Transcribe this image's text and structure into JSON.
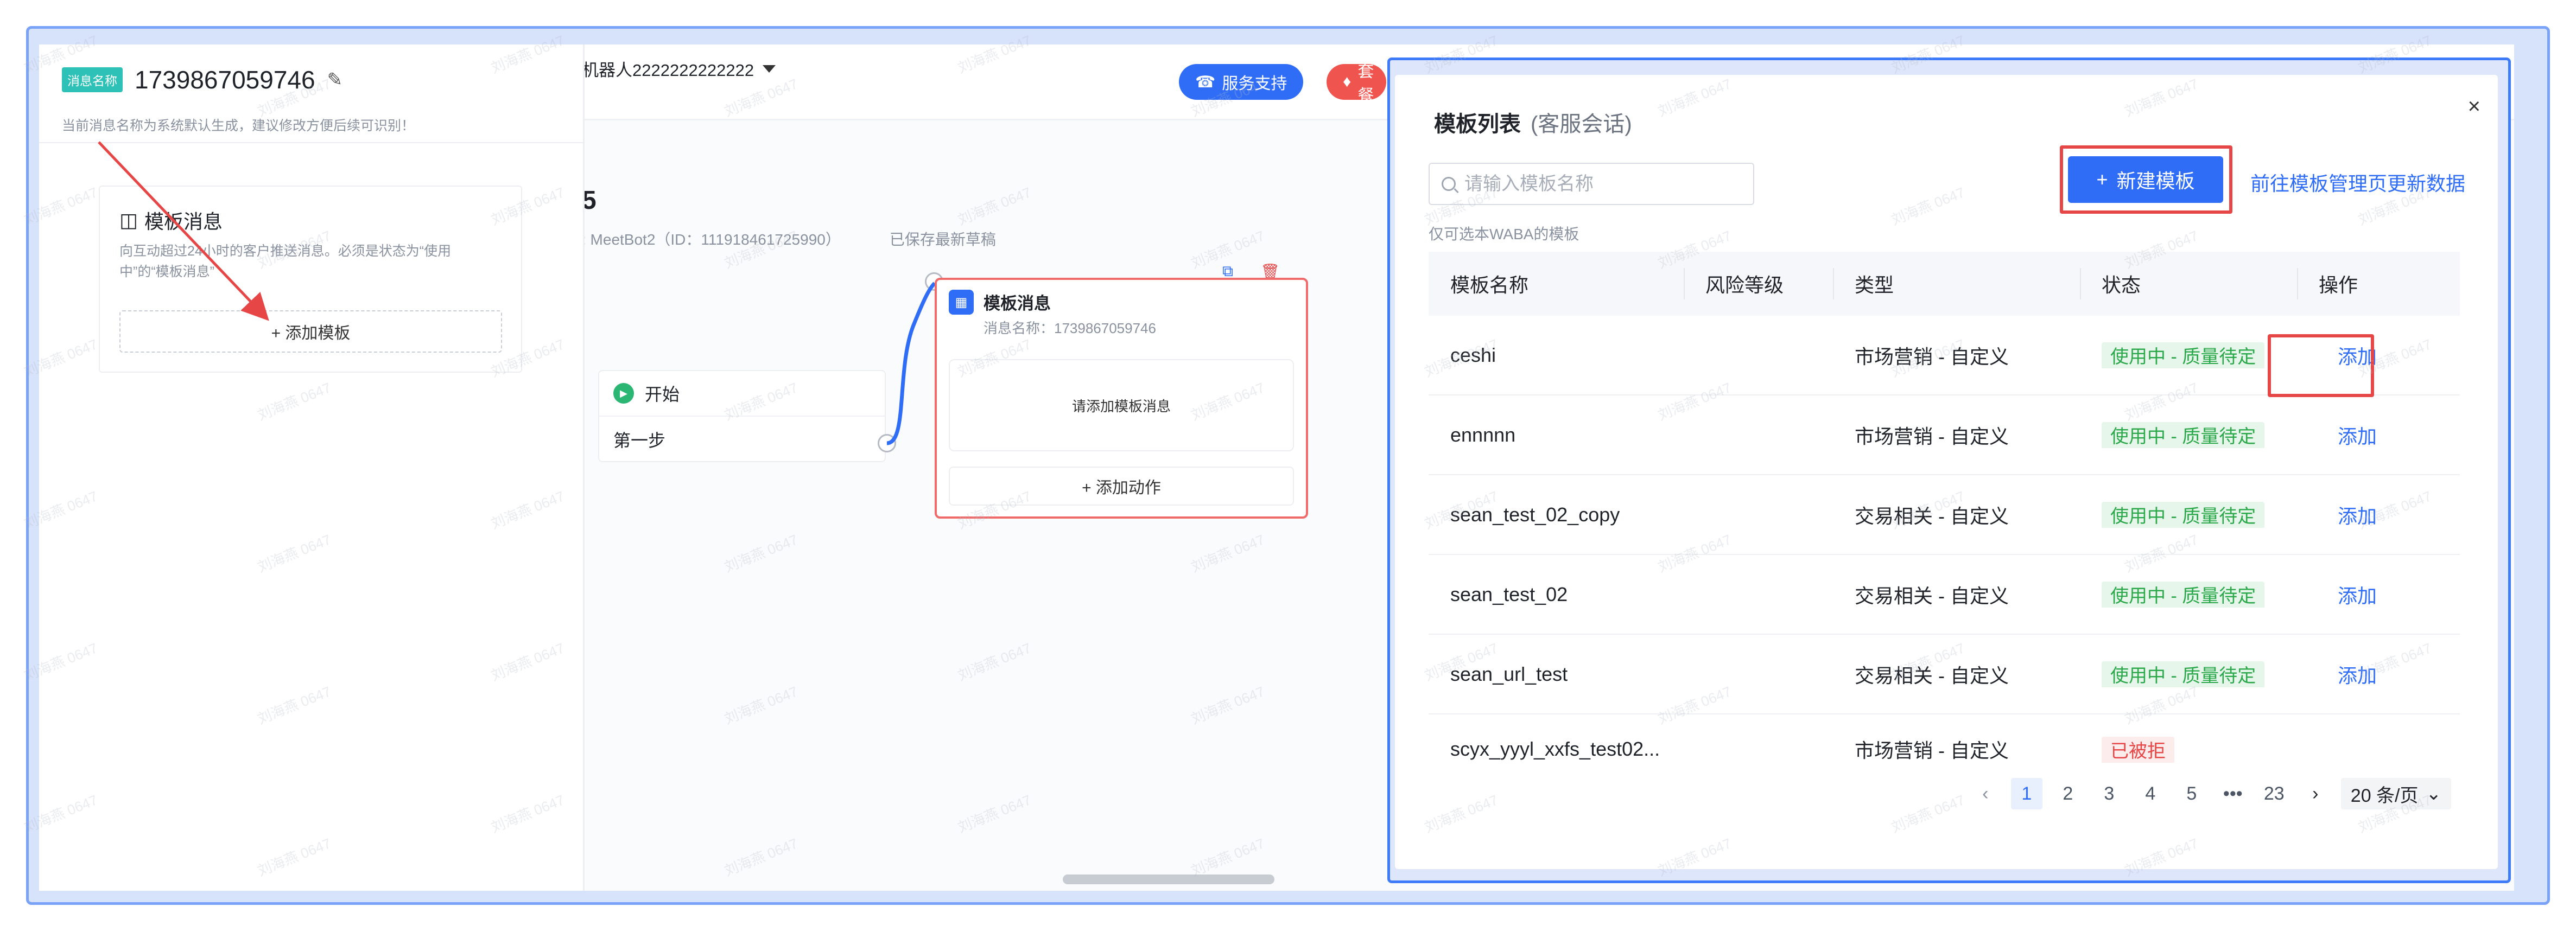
{
  "topbar": {
    "bot_name": "机器人2222222222222",
    "support_button": "服务支持",
    "package_button": "套餐"
  },
  "canvas": {
    "title_fragment": "5",
    "bot_meta": ": MeetBot2（ID：111918461725990）",
    "save_status": "已保存最新草稿",
    "start_node": {
      "label": "开始",
      "step": "第一步"
    },
    "template_node": {
      "title": "模板消息",
      "subtitle": "消息名称：1739867059746",
      "empty_text": "请添加模板消息",
      "add_action": "+ 添加动作"
    }
  },
  "left_panel": {
    "tag": "消息名称",
    "message_name": "1739867059746",
    "hint": "当前消息名称为系统默认生成，建议修改方便后续可识别！",
    "card": {
      "title": "模板消息",
      "description": "向互动超过24小时的客户推送消息。必须是状态为“使用中”的“模板消息”",
      "add_button": "+ 添加模板"
    }
  },
  "modal": {
    "title": "模板列表",
    "subtitle": "(客服会话)",
    "close": "×",
    "search_placeholder": "请输入模板名称",
    "new_button": "新建模板",
    "goto_link": "前往模板管理页更新数据",
    "waba_hint": "仅可选本WABA的模板",
    "columns": [
      "模板名称",
      "风险等级",
      "类型",
      "状态",
      "操作"
    ],
    "rows": [
      {
        "name": "ceshi",
        "risk": "",
        "type": "市场营销 - 自定义",
        "status": "使用中 - 质量待定",
        "status_kind": "ok",
        "action": "添加"
      },
      {
        "name": "ennnnn",
        "risk": "",
        "type": "市场营销 - 自定义",
        "status": "使用中 - 质量待定",
        "status_kind": "ok",
        "action": "添加"
      },
      {
        "name": "sean_test_02_copy",
        "risk": "",
        "type": "交易相关 - 自定义",
        "status": "使用中 - 质量待定",
        "status_kind": "ok",
        "action": "添加"
      },
      {
        "name": "sean_test_02",
        "risk": "",
        "type": "交易相关 - 自定义",
        "status": "使用中 - 质量待定",
        "status_kind": "ok",
        "action": "添加"
      },
      {
        "name": "sean_url_test",
        "risk": "",
        "type": "交易相关 - 自定义",
        "status": "使用中 - 质量待定",
        "status_kind": "ok",
        "action": "添加"
      },
      {
        "name": "scyx_yyyl_xxfs_test02...",
        "risk": "",
        "type": "市场营销 - 自定义",
        "status": "已被拒",
        "status_kind": "rejected",
        "action": ""
      }
    ],
    "pagination": {
      "prev": "‹",
      "pages": [
        "1",
        "2",
        "3",
        "4",
        "5"
      ],
      "ellipsis": "•••",
      "last": "23",
      "next": "›",
      "current": "1",
      "page_size": "20 条/页"
    }
  },
  "watermark_text": "刘海燕 0647",
  "colors": {
    "primary": "#2f6df6",
    "danger": "#e64646",
    "success": "#2ba84a",
    "teal_tag": "#2ec1b8"
  }
}
